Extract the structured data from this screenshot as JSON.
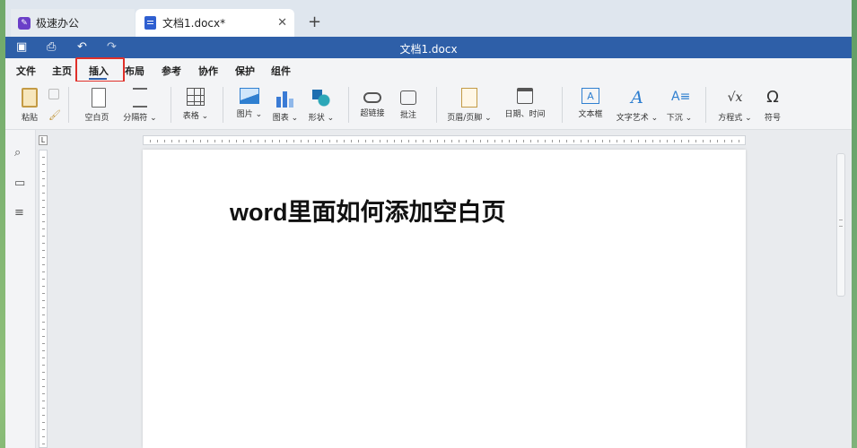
{
  "tabs": [
    {
      "label": "极速办公"
    },
    {
      "label": "文档1.docx*"
    }
  ],
  "titlebar": {
    "title": "文档1.docx"
  },
  "menu": [
    "文件",
    "主页",
    "插入",
    "布局",
    "参考",
    "协作",
    "保护",
    "组件"
  ],
  "ribbon": {
    "paste": "粘贴",
    "blank_page": "空白页",
    "page_break": "分隔符",
    "table": "表格",
    "picture": "图片",
    "chart": "图表",
    "shape": "形状",
    "hyperlink": "超链接",
    "comment": "批注",
    "header_footer": "页眉/页脚",
    "date_time": "日期、时间",
    "text_box": "文本框",
    "text_art": "文字艺术",
    "drop_cap": "下沉",
    "equation": "方程式",
    "symbol": "符号",
    "text_box_glyph": "A",
    "text_art_glyph": "A",
    "drop_cap_glyph": "A≡",
    "equation_glyph": "√x",
    "symbol_glyph": "Ω"
  },
  "document": {
    "heading": "word里面如何添加空白页"
  },
  "ruler": {
    "corner": "L"
  },
  "colors": {
    "accent": "#2e5fa8",
    "highlight": "#e0302a"
  },
  "icons": {
    "save": "save-icon",
    "print": "print-icon",
    "undo": "undo-icon",
    "redo": "redo-icon",
    "search": "search-icon",
    "comment": "comment-icon",
    "navigation": "list-icon"
  }
}
